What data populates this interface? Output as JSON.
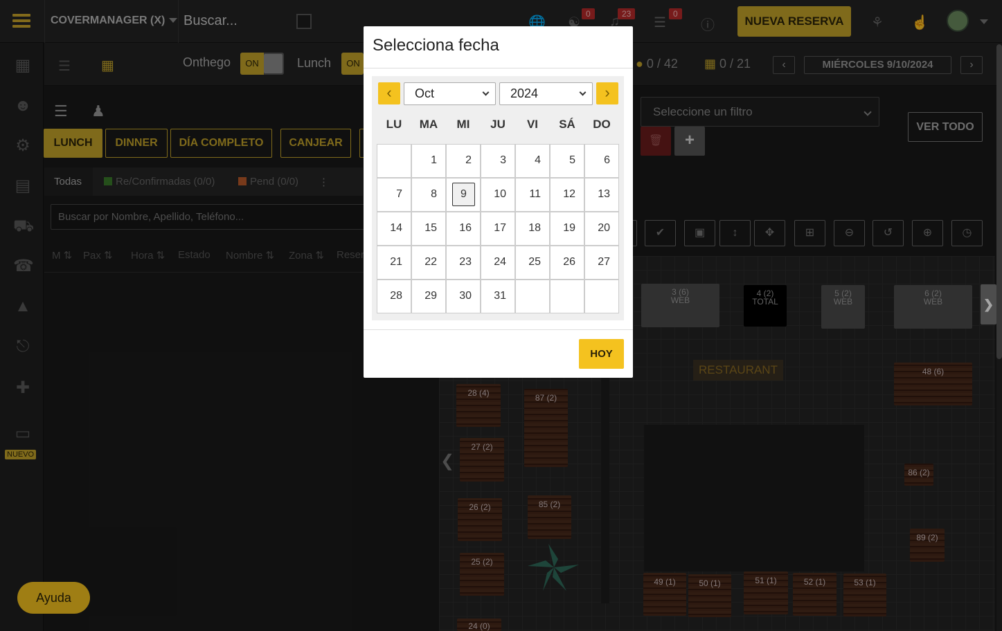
{
  "topbar": {
    "brand": "COVERMANAGER (X)",
    "search_placeholder": "Buscar...",
    "badges": [
      "0",
      "23",
      "0"
    ],
    "new_reservation": "NUEVA RESERVA"
  },
  "sidebar": {
    "icons": [
      "calendar-icon",
      "face-icon",
      "gear-icon",
      "chart-icon",
      "truck-icon",
      "phone-icon",
      "cloche-icon",
      "table-icon",
      "gamepad-icon",
      "ticket-icon"
    ],
    "new_badge": "NUEVO"
  },
  "subbar": {
    "onthego_label": "Onthego",
    "toggle_on": "ON",
    "lunch_label": "Lunch",
    "pax_count": "0 / 42",
    "tables_count": "0 / 21",
    "date": "MIÉRCOLES 9/10/2024"
  },
  "services": [
    "LUNCH",
    "DINNER",
    "DÍA COMPLETO",
    "CANJEAR"
  ],
  "tabs": {
    "all": "Todas",
    "confirmed": "Re/Confirmadas (0/0)",
    "pending": "Pend (0/0)"
  },
  "search_reservations_placeholder": "Buscar por Nombre, Apellido, Teléfono...",
  "columns": [
    "M",
    "Pax",
    "Hora",
    "Estado",
    "Nombre",
    "Zona",
    "Reser"
  ],
  "filter": {
    "placeholder": "Seleccione un filtro",
    "view_all": "VER TODO"
  },
  "floor": {
    "restaurant_label": "RESTAURANT",
    "top_tables": [
      {
        "label": "3 (6)",
        "sub": "WEB"
      },
      {
        "label": "4 (2)",
        "sub": "TOTAL"
      },
      {
        "label": "5 (2)",
        "sub": "WEB"
      },
      {
        "label": "6 (2)",
        "sub": "WEB"
      }
    ],
    "wood_tables": [
      "28 (4)",
      "87 (2)",
      "27 (2)",
      "26 (2)",
      "85 (2)",
      "25 (2)",
      "24 (0)",
      "48 (6)",
      "86 (2)",
      "89 (2)",
      "49 (1)",
      "50 (1)",
      "51 (1)",
      "52 (1)",
      "53 (1)"
    ]
  },
  "help": "Ayuda",
  "modal": {
    "title": "Selecciona fecha",
    "month": "Oct",
    "year": "2024",
    "weekdays": [
      "LU",
      "MA",
      "MI",
      "JU",
      "VI",
      "SÁ",
      "DO"
    ],
    "weeks": [
      [
        "",
        "1",
        "2",
        "3",
        "4",
        "5",
        "6"
      ],
      [
        "7",
        "8",
        "9",
        "10",
        "11",
        "12",
        "13"
      ],
      [
        "14",
        "15",
        "16",
        "17",
        "18",
        "19",
        "20"
      ],
      [
        "21",
        "22",
        "23",
        "24",
        "25",
        "26",
        "27"
      ],
      [
        "28",
        "29",
        "30",
        "31",
        "",
        "",
        ""
      ]
    ],
    "selected_day": "9",
    "today_button": "HOY"
  },
  "colors": {
    "accent": "#f4c21f",
    "accent_dark": "#c4a42a",
    "background": "#1a1a1a"
  }
}
